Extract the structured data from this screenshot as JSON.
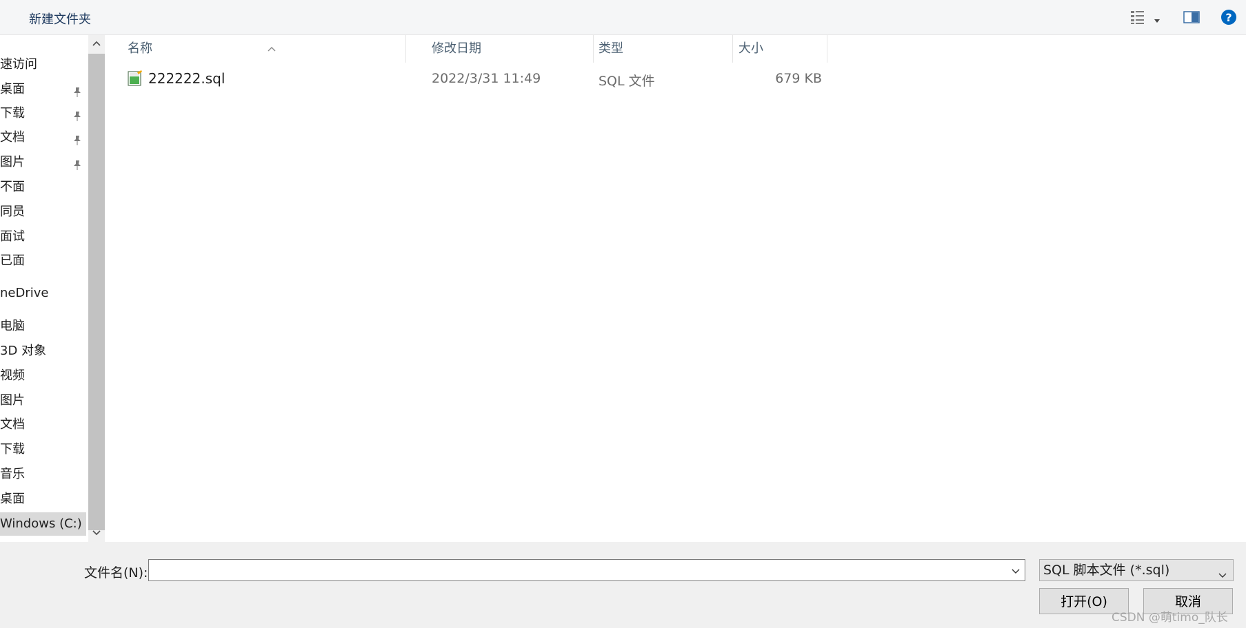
{
  "toolbar": {
    "new_folder_label": "新建文件夹"
  },
  "sidebar": {
    "items": [
      {
        "label": "速访问",
        "pinned": false
      },
      {
        "label": "桌面",
        "pinned": true
      },
      {
        "label": "下载",
        "pinned": true
      },
      {
        "label": "文档",
        "pinned": true
      },
      {
        "label": "图片",
        "pinned": true
      },
      {
        "label": "不面",
        "pinned": false
      },
      {
        "label": "同员",
        "pinned": false
      },
      {
        "label": "面试",
        "pinned": false
      },
      {
        "label": "已面",
        "pinned": false
      },
      {
        "label": "neDrive",
        "pinned": false
      },
      {
        "label": "电脑",
        "pinned": false
      },
      {
        "label": "3D 对象",
        "pinned": false
      },
      {
        "label": "视频",
        "pinned": false
      },
      {
        "label": "图片",
        "pinned": false
      },
      {
        "label": "文档",
        "pinned": false
      },
      {
        "label": "下载",
        "pinned": false
      },
      {
        "label": "音乐",
        "pinned": false
      },
      {
        "label": "桌面",
        "pinned": false
      },
      {
        "label": "Windows (C:)",
        "pinned": false,
        "selected": true
      }
    ]
  },
  "columns": {
    "name": "名称",
    "date": "修改日期",
    "type": "类型",
    "size": "大小"
  },
  "files": [
    {
      "name": "222222.sql",
      "date": "2022/3/31 11:49",
      "type": "SQL 文件",
      "size": "679 KB"
    }
  ],
  "bottom": {
    "filename_label": "文件名(N):",
    "filename_value": "",
    "filetype_value": "SQL 脚本文件 (*.sql)",
    "open_label": "打开(O)",
    "cancel_label": "取消"
  },
  "watermark": "CSDN @萌timo_队长",
  "colors": {
    "toolbar_bg": "#f5f6f7",
    "bottom_bg": "#f0f0f0",
    "selected_bg": "#d9d9d9",
    "header_text": "#4c6072",
    "help_blue": "#0067c0"
  }
}
